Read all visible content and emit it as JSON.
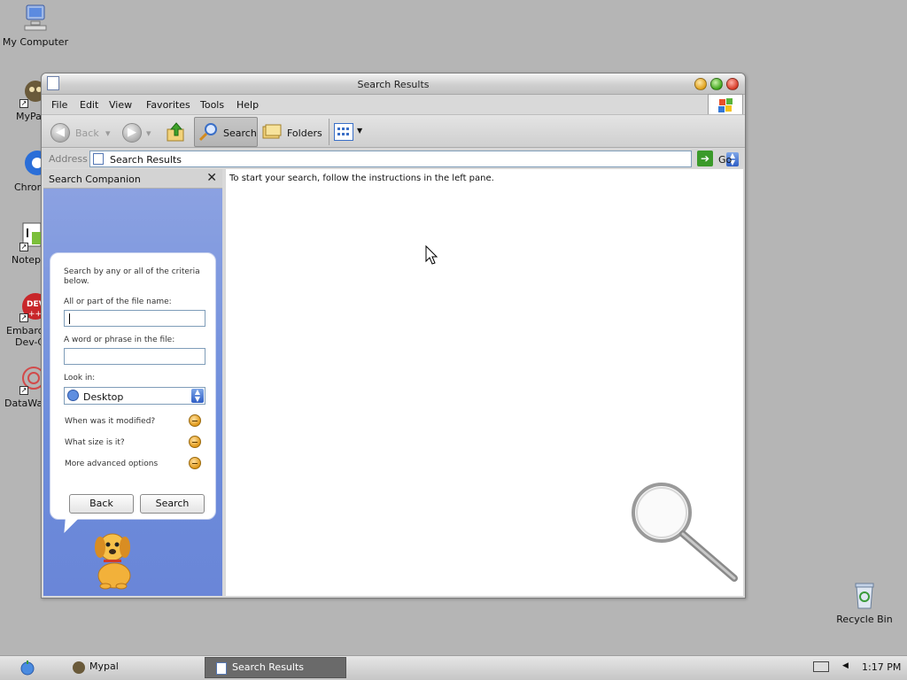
{
  "desktop": {
    "icons": [
      {
        "label": "My Computer"
      },
      {
        "label": "MyPal"
      },
      {
        "label": "Chrom"
      },
      {
        "label": "Notepa"
      },
      {
        "label": "Embarca"
      },
      {
        "label": "Dev-C"
      },
      {
        "label": "DataWag"
      },
      {
        "label": "Recycle Bin"
      }
    ]
  },
  "window": {
    "title": "Search Results",
    "menu": [
      "File",
      "Edit",
      "View",
      "Favorites",
      "Tools",
      "Help"
    ],
    "toolbar": {
      "back_label": "Back",
      "search_label": "Search",
      "folders_label": "Folders"
    },
    "address": {
      "label": "Address",
      "value": "Search Results",
      "go_label": "Go"
    }
  },
  "search_companion": {
    "header": "Search Companion",
    "close_glyph": "✕",
    "intro": "Search by any or all of the criteria below.",
    "name_label": "All or part of the file name:",
    "name_value": "",
    "phrase_label": "A word or phrase in the file:",
    "phrase_value": "",
    "lookin_label": "Look in:",
    "lookin_value": "Desktop",
    "options": [
      "When was it modified?",
      "What size is it?",
      "More advanced options"
    ],
    "back_button": "Back",
    "search_button": "Search"
  },
  "results_pane": {
    "instructions": "To start your search, follow the instructions in the left pane."
  },
  "taskbar": {
    "tasks": [
      "Mypal",
      "Search Results"
    ],
    "clock": "1:17 PM"
  },
  "colors": {
    "desktop": "#b5b5b5",
    "pane_blue": "#6d8ddb",
    "active_task": "#6a6a6a"
  }
}
